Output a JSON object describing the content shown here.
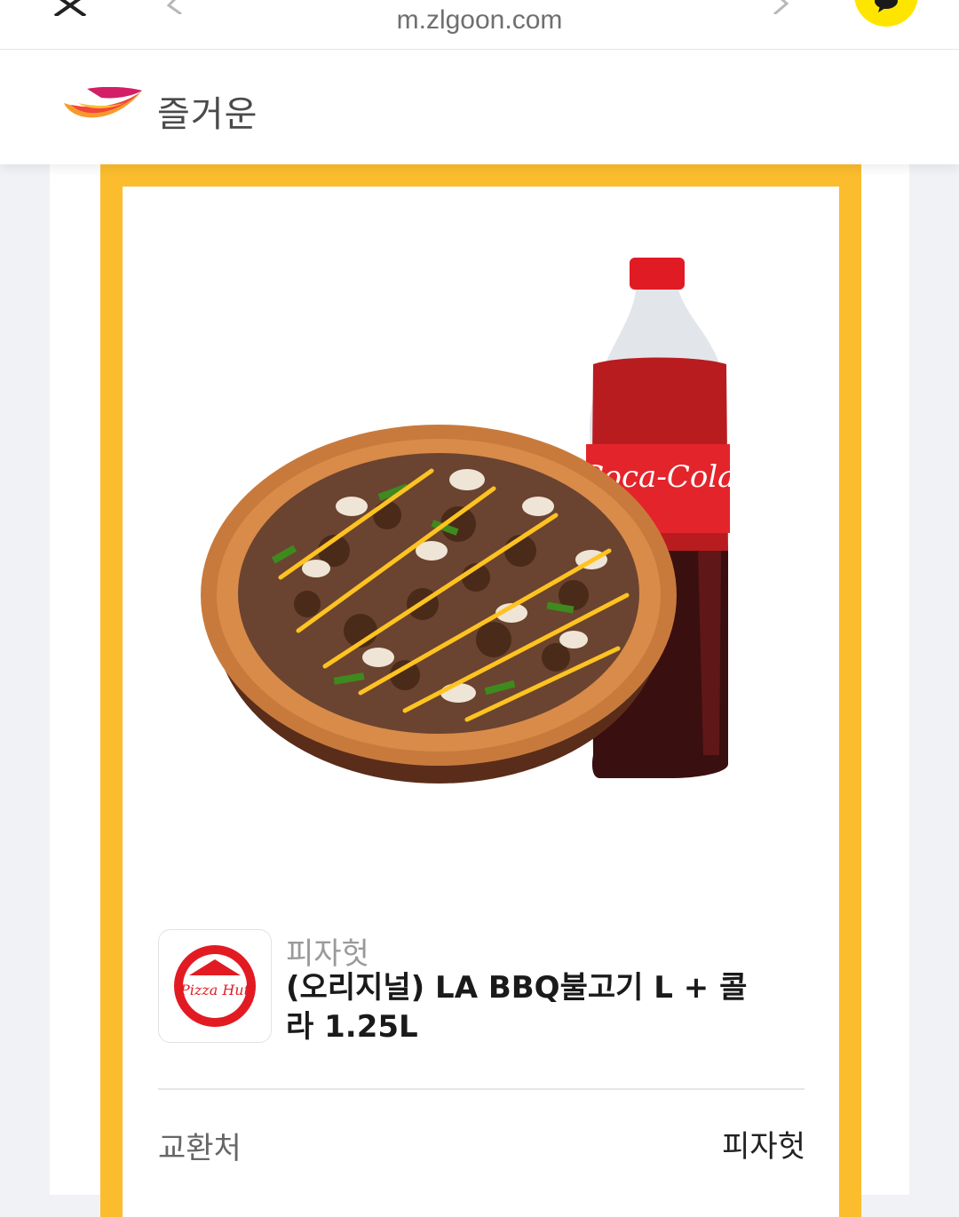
{
  "browser": {
    "url": "m.zlgoon.com",
    "close_icon": "close-icon",
    "back_icon": "chevron-left-icon",
    "forward_icon": "chevron-right-icon",
    "chat_icon": "kakao-chat-icon",
    "chat_color": "#fee500"
  },
  "header": {
    "logo_text": "즐거운",
    "logo_colors": [
      "#f2453d",
      "#f79a2b",
      "#fbbd2e",
      "#d21f66"
    ]
  },
  "coupon": {
    "border_color": "#fbbd2e",
    "image_alt": "pizza-and-cola-image",
    "brand_logo_text": "Pizza Hut",
    "brand_name": "피자헛",
    "product_name": "(오리지널) LA BBQ불고기 L + 콜라 1.25L",
    "bottle_label": "Coca-Cola",
    "details": [
      {
        "label": "교환처",
        "value": "피자헛"
      }
    ]
  }
}
